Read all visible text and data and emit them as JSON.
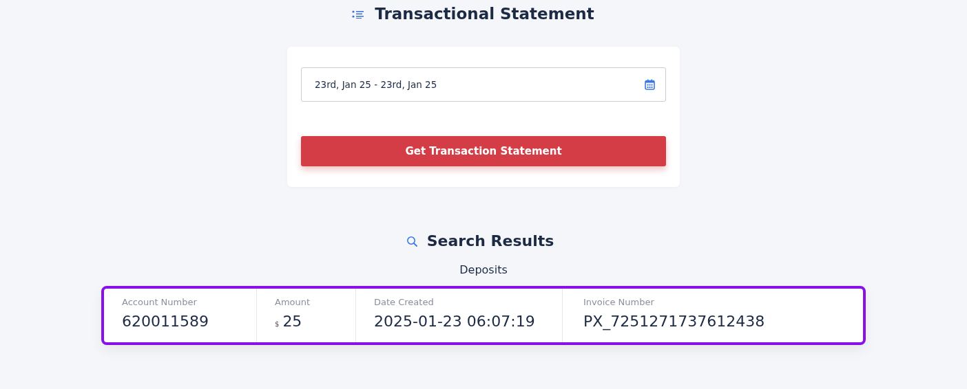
{
  "page_title": "Transactional Statement",
  "date_range": {
    "value": "23rd, Jan 25 - 23rd, Jan 25"
  },
  "submit_button": "Get Transaction Statement",
  "results_title": "Search Results",
  "section_title": "Deposits",
  "highlighted": true,
  "deposit_fields": [
    {
      "label": "Account Number",
      "value": "620011589"
    },
    {
      "label": "Amount",
      "currency": "$",
      "value": "25"
    },
    {
      "label": "Date Created",
      "value": "2025-01-23 06:07:19"
    },
    {
      "label": "Invoice Number",
      "value": "PX_7251271737612438"
    }
  ]
}
